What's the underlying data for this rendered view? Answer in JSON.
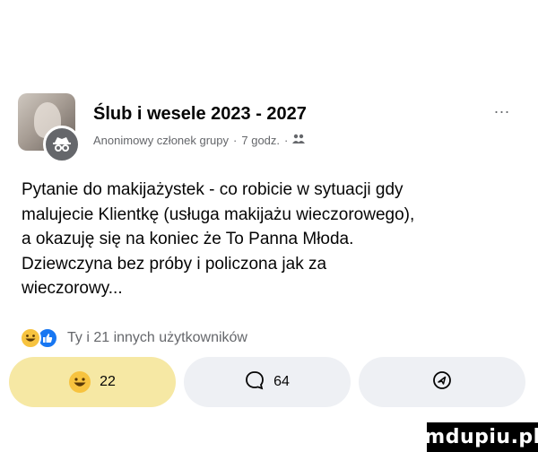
{
  "post": {
    "group_name": "Ślub i wesele 2023 - 2027",
    "author": "Anonimowy członek grupy",
    "separator": "·",
    "time": "7 godz.",
    "more_label": "...",
    "text": "Pytanie do makijażystek - co robicie w sytuacji gdy\nmalujecie Klientkę (usługa makijażu wieczorowego),\na okazuję się na koniec że To Panna Młoda.\nDziewczyna bez próby i policzona jak za\nwieczorowy..."
  },
  "reactions": {
    "summary": "Ty i 21 innych użytkowników"
  },
  "actions": {
    "react_count": "22",
    "comment_count": "64"
  },
  "watermark": "mdupiu.pl",
  "colors": {
    "like_blue": "#1877f2",
    "laugh_yellow": "#f7c33f",
    "active_pill": "#f6e8a4",
    "pill_grey": "#eef0f4"
  },
  "icons": [
    "group-avatar",
    "anonymous-icon",
    "privacy-icon",
    "more-icon",
    "laugh-icon",
    "like-icon",
    "comment-icon",
    "share-icon"
  ]
}
